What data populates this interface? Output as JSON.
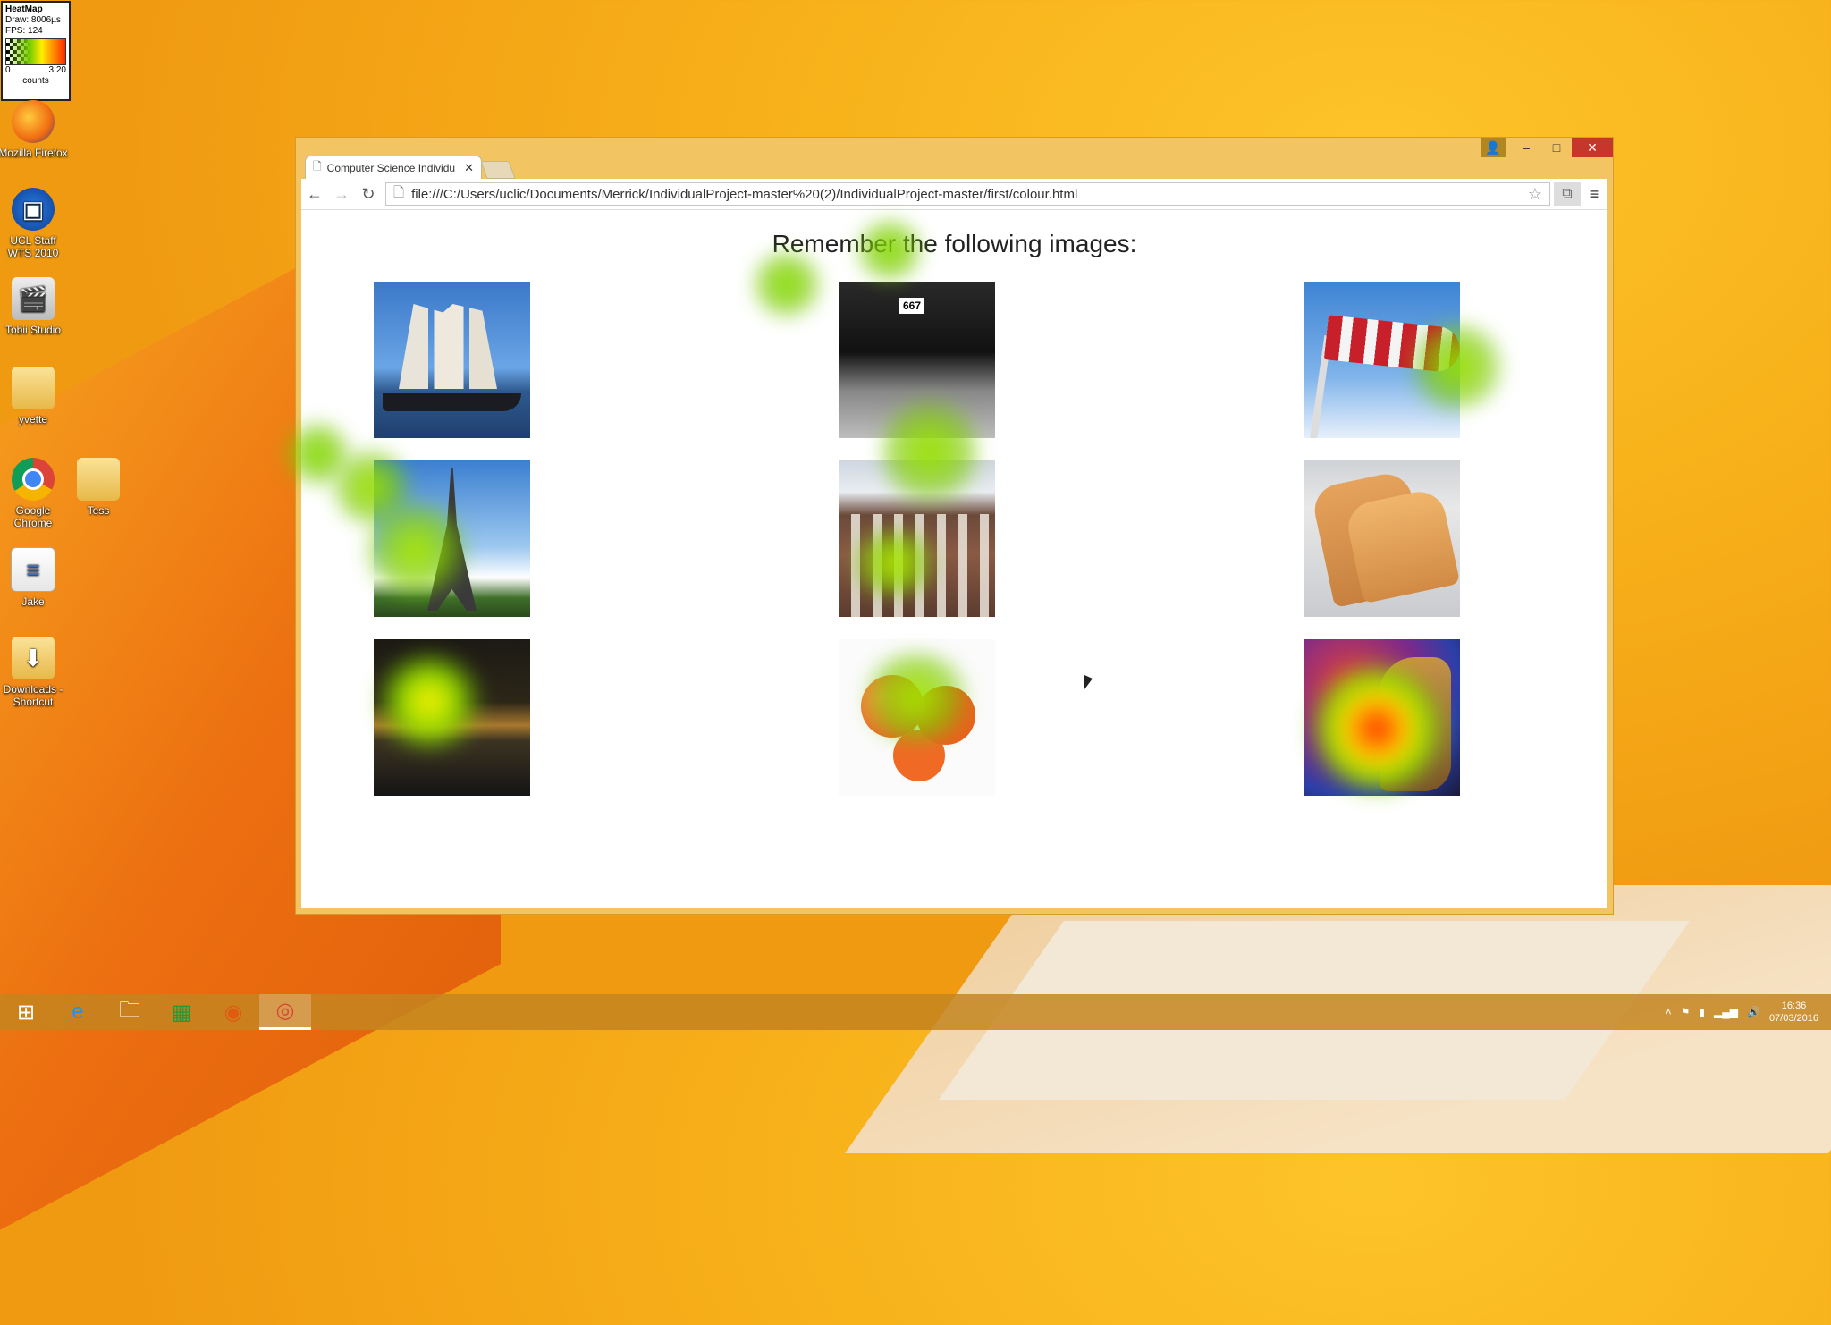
{
  "heatmap_widget": {
    "title": "HeatMap",
    "draw": "Draw: 8006µs",
    "fps": "FPS: 124",
    "scale_min": "0",
    "scale_max": "3.20",
    "unit": "counts"
  },
  "desktop": {
    "icons": [
      {
        "label": "Mozilla Firefox",
        "icon": "firefox-icon"
      },
      {
        "label": "UCL Staff WTS 2010",
        "icon": "remote-desktop-icon"
      },
      {
        "label": "Tobii Studio",
        "icon": "clapperboard-icon"
      },
      {
        "label": "yvette",
        "icon": "folder-icon"
      },
      {
        "label": "Google Chrome",
        "icon": "chrome-icon"
      },
      {
        "label": "Tess",
        "icon": "folder-icon"
      },
      {
        "label": "Jake",
        "icon": "document-icon"
      },
      {
        "label": "Downloads - Shortcut",
        "icon": "downloads-folder-icon"
      }
    ]
  },
  "browser": {
    "tab_title": "Computer Science Individu",
    "url": "file:///C:/Users/uclic/Documents/Merrick/IndividualProject-master%20(2)/IndividualProject-master/first/colour.html",
    "window_buttons": {
      "minimize": "–",
      "maximize": "□",
      "close": "✕"
    }
  },
  "page": {
    "heading": "Remember the following images:",
    "images": [
      {
        "name": "sailing-ship-image"
      },
      {
        "name": "marathon-runners-image"
      },
      {
        "name": "windsock-image"
      },
      {
        "name": "eiffel-tower-image"
      },
      {
        "name": "townhouses-image"
      },
      {
        "name": "toast-image"
      },
      {
        "name": "night-city-image"
      },
      {
        "name": "oranges-image"
      },
      {
        "name": "dragon-image"
      }
    ]
  },
  "heat_colors": {
    "low": "#77cc00",
    "mid": "#ffee00",
    "high": "#ff2a00"
  },
  "taskbar": {
    "items": [
      "windows-start-icon",
      "internet-explorer-icon",
      "file-explorer-icon",
      "store-icon",
      "firefox-icon",
      "chrome-icon"
    ],
    "time": "16:36",
    "date": "07/03/2016"
  }
}
